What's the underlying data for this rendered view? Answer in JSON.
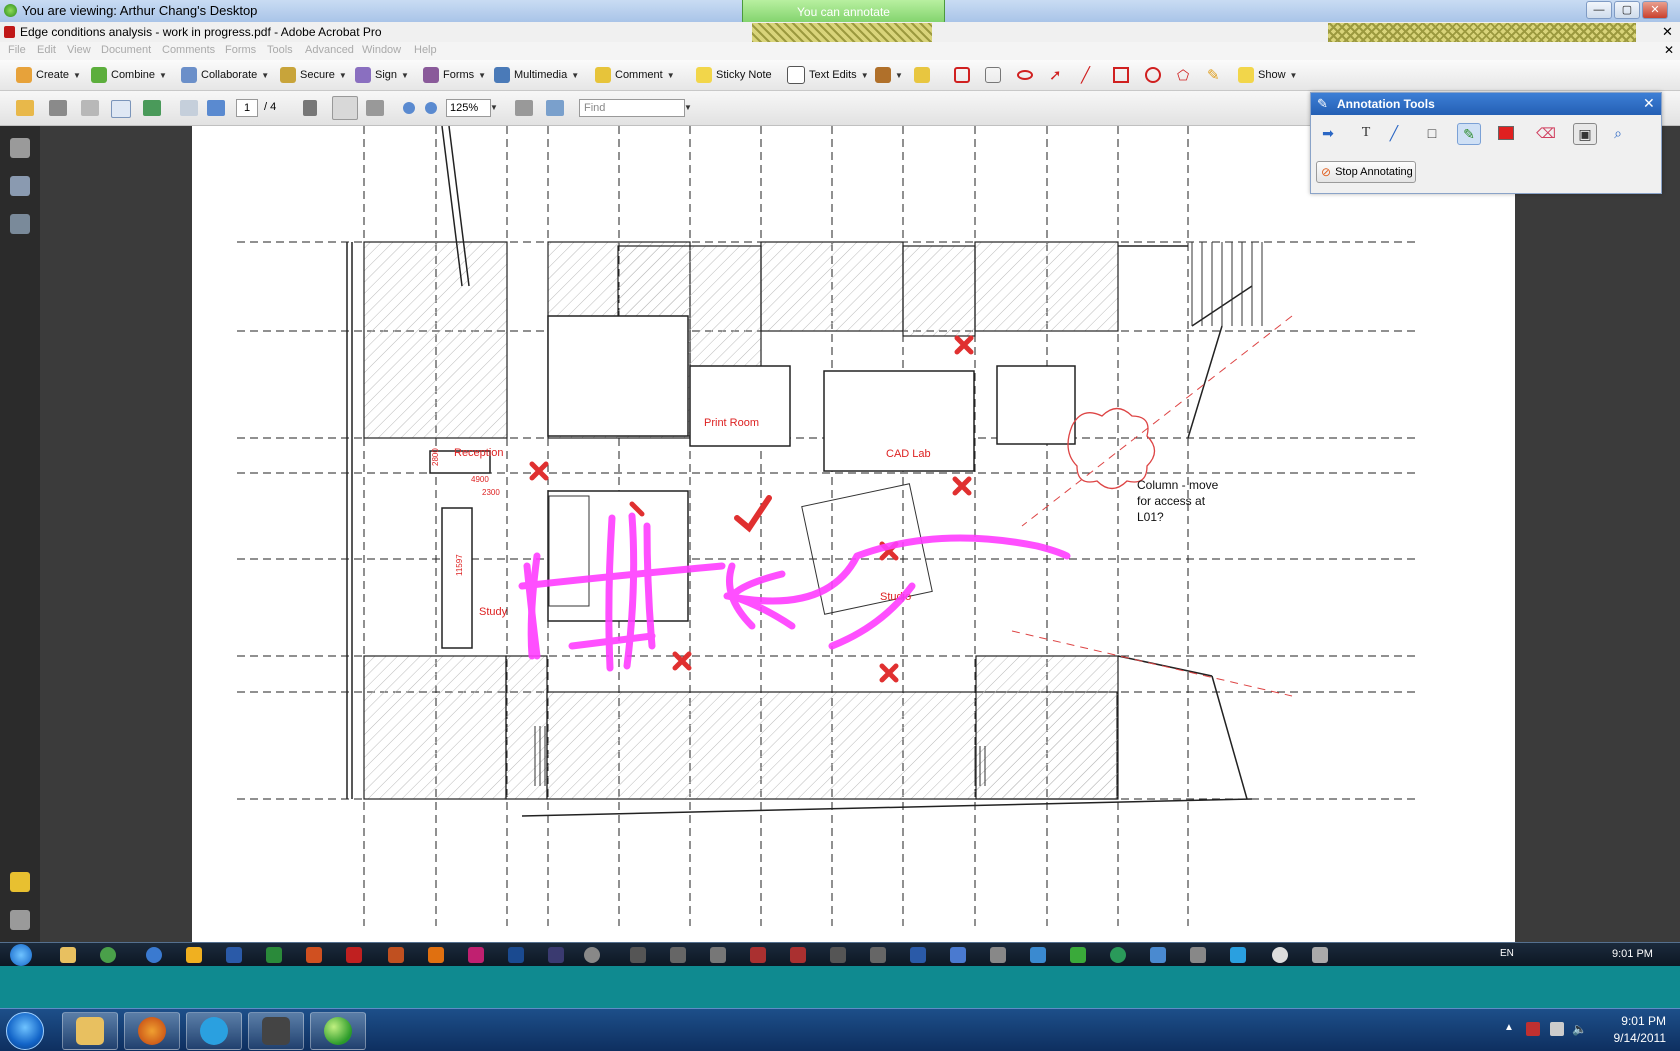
{
  "remote": {
    "viewing_title": "You are viewing: Arthur Chang's Desktop",
    "annotate_badge": "You can annotate"
  },
  "app": {
    "window_title": "Edge conditions analysis - work in progress.pdf - Adobe Acrobat Pro"
  },
  "menu": [
    "File",
    "Edit",
    "View",
    "Document",
    "Comments",
    "Forms",
    "Tools",
    "Advanced",
    "Window",
    "Help"
  ],
  "toolbar": {
    "create": "Create",
    "combine": "Combine",
    "collaborate": "Collaborate",
    "secure": "Secure",
    "sign": "Sign",
    "forms": "Forms",
    "multimedia": "Multimedia",
    "comment": "Comment",
    "sticky_note": "Sticky Note",
    "text_edits": "Text Edits",
    "show": "Show"
  },
  "nav": {
    "page_current": "1",
    "page_total": "/ 4",
    "zoom": "125%",
    "find_placeholder": "Find"
  },
  "annotation_tools": {
    "title": "Annotation Tools",
    "stop_label": "Stop Annotating"
  },
  "plan": {
    "labels": {
      "reception": "Reception",
      "print_room": "Print Room",
      "cad_lab": "CAD Lab",
      "study": "Study",
      "studio": "Studio",
      "dim_4900": "4900",
      "dim_2300": "2300",
      "dim_11597": "11597",
      "dim_2800": "2800"
    },
    "note_lines": [
      "Column - move",
      "for access at",
      "L01?"
    ]
  },
  "remote_taskbar": {
    "lang": "EN",
    "clock": "9:01 PM"
  },
  "local_taskbar": {
    "time": "9:01 PM",
    "date": "9/14/2011"
  },
  "colors": {
    "highlighter": "#ff3dff",
    "markup_red": "#e03030",
    "accent_blue": "#2a66c4"
  }
}
